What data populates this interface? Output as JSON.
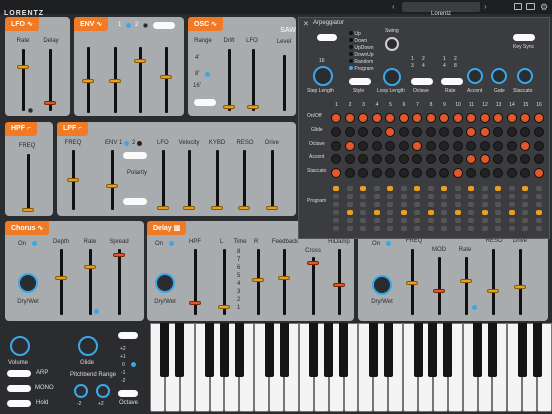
{
  "header": {
    "logo": "LORENTZ",
    "preset_name": "Lorentz",
    "fx_label": "Fx"
  },
  "lfo": {
    "tab": "LFO",
    "rate": "Rate",
    "delay": "Delay"
  },
  "env": {
    "tab": "ENV",
    "opt1": "1",
    "opt2": "2"
  },
  "osc": {
    "tab": "OSC",
    "range": "Range",
    "drift": "Drift",
    "lfo": "LFO",
    "saw": "SAW",
    "level": "Level",
    "range_values": [
      "4'",
      "8'",
      "16'"
    ]
  },
  "hpf": {
    "tab": "HPF",
    "freq": "FREQ"
  },
  "lpf": {
    "tab": "LPF",
    "freq": "FREQ",
    "env": "ENV",
    "env1": "1",
    "env2": "2",
    "lfo": "LFO",
    "velocity": "Velocity",
    "kybd": "KYBD",
    "reso": "RESO",
    "drive": "Drive",
    "polarity": "Polarity"
  },
  "chorus": {
    "tab": "Chorus",
    "on": "On",
    "depth": "Depth",
    "rate": "Rate",
    "spread": "Spread",
    "drywet": "Dry/Wet"
  },
  "delay": {
    "tab": "Delay",
    "on": "On",
    "hpf": "HPF",
    "l": "L",
    "time": "Time",
    "r": "R",
    "feedback": "Feedback",
    "cross": "Cross",
    "hidamp": "HiDamp",
    "drywet": "Dry/Wet",
    "time_scale": [
      "8",
      "7",
      "6",
      "5",
      "4",
      "3",
      "2",
      "1"
    ]
  },
  "reverb": {
    "on": "On",
    "freq": "FREQ",
    "mod": "MOD",
    "rate": "Rate",
    "reso": "RESO",
    "drive": "Drive",
    "drywet": "Dry/Wet"
  },
  "bottom": {
    "volume": "Volume",
    "arp": "ARP",
    "mono": "MONO",
    "hold": "Hold",
    "glide": "Glide",
    "pitchbend": "Pitchbend Range",
    "pb_minus": "-2",
    "pb_plus": "+2",
    "octave": "Octave",
    "oct_values": [
      "+2",
      "+1",
      "0",
      "-1",
      "-2"
    ]
  },
  "arpeggiator": {
    "title": "Arpeggiator",
    "modes": [
      "Up",
      "Down",
      "UpDown",
      "DownUp",
      "Random",
      "Program"
    ],
    "step_length": "Step Length",
    "step_value": "16",
    "style": "Style",
    "swing": "Swing",
    "loop_length": "Loop Length",
    "octave": "Octave",
    "rate": "Rate",
    "accent": "Accent",
    "gate": "Gate",
    "staccato": "Staccato",
    "key_sync": "Key Sync",
    "oct_opts": [
      "1",
      "2",
      "3",
      "4"
    ],
    "rate_opts": [
      "1",
      "2",
      "4",
      "8"
    ],
    "rows": [
      "On/Off",
      "Glide",
      "Octave",
      "Accent",
      "Staccato",
      "Program"
    ],
    "steps": [
      "1",
      "2",
      "3",
      "4",
      "5",
      "6",
      "7",
      "8",
      "9",
      "10",
      "11",
      "12",
      "13",
      "14",
      "15",
      "16"
    ]
  }
}
